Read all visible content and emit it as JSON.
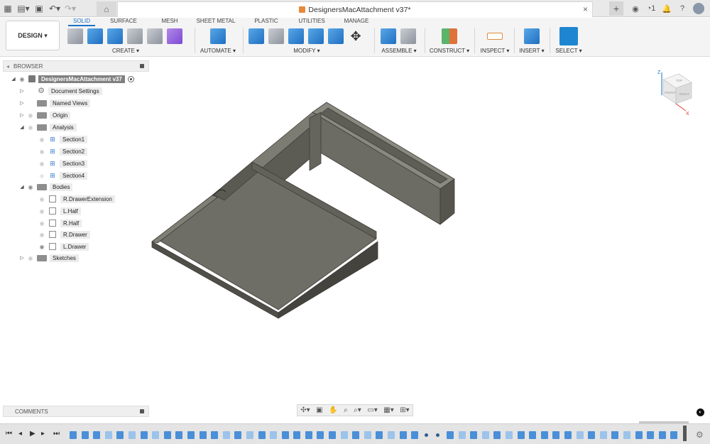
{
  "window": {
    "doc_title": "DesignersMacAttachment v37*",
    "notifications_count": "1"
  },
  "toolbar": {
    "workspace": "DESIGN ▾",
    "tabs": [
      "SOLID",
      "SURFACE",
      "MESH",
      "SHEET METAL",
      "PLASTIC",
      "UTILITIES",
      "MANAGE"
    ],
    "active_tab": "SOLID",
    "groups": {
      "create": "CREATE ▾",
      "automate": "AUTOMATE ▾",
      "modify": "MODIFY ▾",
      "assemble": "ASSEMBLE ▾",
      "construct": "CONSTRUCT ▾",
      "inspect": "INSPECT ▾",
      "insert": "INSERT ▾",
      "select": "SELECT ▾"
    }
  },
  "browser": {
    "title": "BROWSER",
    "root": "DesignersMacAttachment v37",
    "items": [
      {
        "label": "Document Settings"
      },
      {
        "label": "Named Views"
      },
      {
        "label": "Origin"
      },
      {
        "label": "Analysis"
      },
      {
        "label": "Section1"
      },
      {
        "label": "Section2"
      },
      {
        "label": "Section3"
      },
      {
        "label": "Section4"
      },
      {
        "label": "Bodies"
      },
      {
        "label": "R.DrawerExtension"
      },
      {
        "label": "L.Half"
      },
      {
        "label": "R.Half"
      },
      {
        "label": "R.Drawer"
      },
      {
        "label": "L.Drawer"
      },
      {
        "label": "Sketches"
      }
    ]
  },
  "viewcube": {
    "axis_z": "Z",
    "axis_x": "X",
    "face_top": "TOP",
    "face_front": "FRONT",
    "face_right": "RIGHT"
  },
  "comments": {
    "title": "COMMENTS"
  },
  "colors": {
    "accent": "#1a73c8",
    "model": "#6b6a62",
    "select": "#1e86d0"
  }
}
